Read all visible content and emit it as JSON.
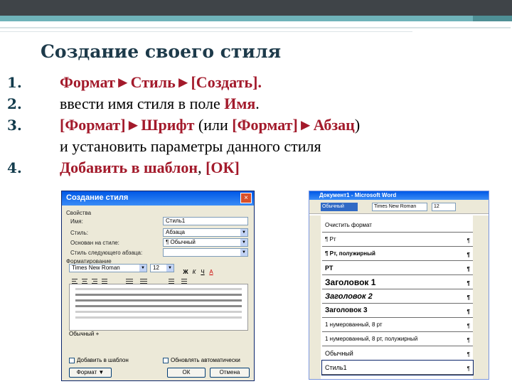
{
  "slide": {
    "title": "Создание своего стиля",
    "steps": [
      {
        "num": "1.",
        "a": "Формат►Стиль►[Создать]."
      },
      {
        "num": "2.",
        "a": "ввести имя стиля в поле ",
        "b": "Имя",
        "c": "."
      },
      {
        "num": "3.",
        "a": " [Формат]►Шрифт",
        "b": " (или ",
        "c": "[Формат]►Абзац",
        "d": ")",
        "cont": "и установить параметры данного стиля"
      },
      {
        "num": "4.",
        "a": "Добавить в шаблон",
        "b": ", ",
        "c": "[ОК]"
      }
    ]
  },
  "dialog": {
    "title": "Создание стиля",
    "close": "×",
    "group_props": "Свойства",
    "name_label": "Имя:",
    "name_value": "Стиль1",
    "style_label": "Стиль:",
    "style_value": "Абзаца",
    "based_label": "Основан на стиле:",
    "based_value": "¶ Обычный",
    "next_label": "Стиль следующего абзаца:",
    "next_value": "",
    "group_format": "Форматирование",
    "font_value": "Times New Roman",
    "size_value": "12",
    "desc": "Обычный +",
    "add_template": "Добавить в шаблон",
    "auto_update": "Обновлять автоматически",
    "format_btn": "Формат ▼",
    "ok_btn": "ОК",
    "cancel_btn": "Отмена",
    "toolbar": [
      "Ж",
      "К",
      "Ч",
      "A"
    ]
  },
  "word": {
    "title": "Документ1 - Microsoft Word",
    "style_box": "Обычный",
    "font_box": "Times New Roman",
    "size_box": "12",
    "items": [
      {
        "label": "Очистить формат",
        "size": 8
      },
      {
        "label": "¶ Рт",
        "size": 8
      },
      {
        "label": "¶ Рт, полужирный",
        "size": 8
      },
      {
        "label": "РТ",
        "size": 9
      },
      {
        "label": "Заголовок 1",
        "size": 12,
        "bold": true
      },
      {
        "label": "Заголовок 2",
        "size": 11,
        "bold": true,
        "italic": true
      },
      {
        "label": "Заголовок 3",
        "size": 10,
        "bold": true
      },
      {
        "label": "1 нумерованный, 8 рт",
        "size": 8
      },
      {
        "label": "1 нумерованный, 8 рт, полужирный",
        "size": 8
      },
      {
        "label": "Обычный",
        "size": 9
      },
      {
        "label": "Стиль1",
        "size": 9
      }
    ]
  }
}
